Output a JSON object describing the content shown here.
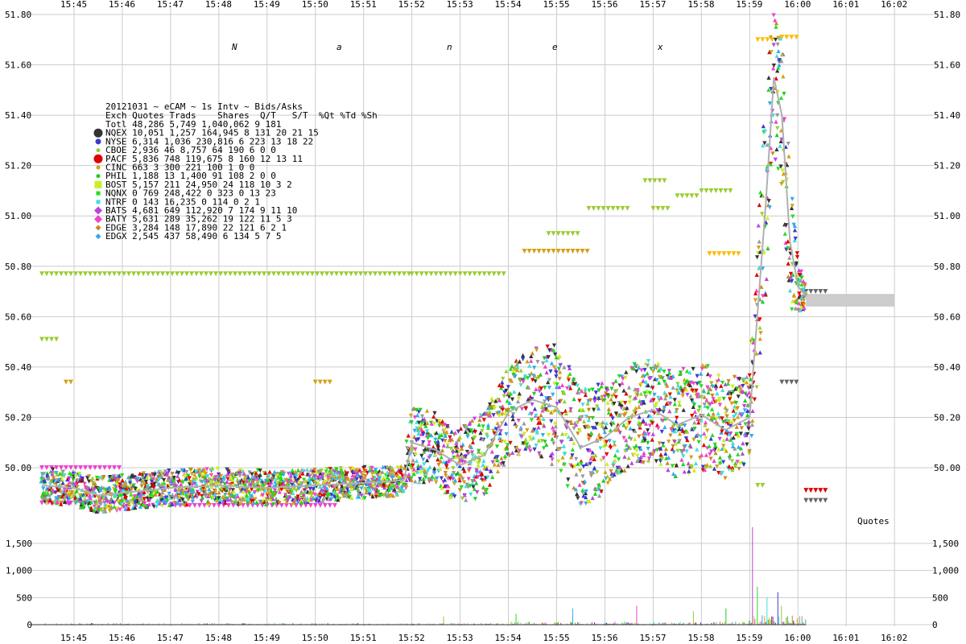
{
  "chart_data": {
    "type": "scatter",
    "watermark_letters": [
      "N",
      "a",
      "n",
      "e",
      "x"
    ],
    "x_ticks": [
      "15:45",
      "15:46",
      "15:47",
      "15:48",
      "15:49",
      "15:50",
      "15:51",
      "15:52",
      "15:53",
      "15:54",
      "15:55",
      "15:56",
      "15:57",
      "15:58",
      "15:59",
      "16:00",
      "16:01",
      "16:02"
    ],
    "price_axis": {
      "ylim": [
        49.78,
        51.82
      ],
      "ticks": [
        50.0,
        50.2,
        50.4,
        50.6,
        50.8,
        51.0,
        51.2,
        51.4,
        51.6,
        51.8
      ],
      "tick_labels": [
        "50.00",
        "50.20",
        "50.40",
        "50.60",
        "50.80",
        "51.00",
        "51.20",
        "51.40",
        "51.60",
        "51.80"
      ]
    },
    "volume_axis": {
      "ylim": [
        0,
        1800
      ],
      "ticks": [
        0,
        500,
        1000,
        1500
      ],
      "tick_labels": [
        "0",
        "500",
        "1,000",
        "1,500"
      ]
    },
    "panel_label": "Quotes",
    "legend": {
      "title": "20121031 ~ eCAM ~ 1s Intv ~ Bids/Asks",
      "header": "Exch Quotes Trads    Shares  Q/T   S/T  %Qt %Td %Sh",
      "rows": [
        {
          "text": "Totl 48,286 5,749 1,040,062    9   181",
          "color": "",
          "marker": "none"
        },
        {
          "text": "NQEX 10,051 1,257   164,945    8   131   20  21  15",
          "color": "#333333",
          "marker": "circle-large"
        },
        {
          "text": "NYSE  6,314 1,036   230,816    6   223   13  18  22",
          "color": "#3a3acc",
          "marker": "circle"
        },
        {
          "text": "CBOE  2,936    46     8,757   64   190    6   0   0",
          "color": "#9acd32",
          "marker": "circle-small"
        },
        {
          "text": "PACF  5,836   748   119,675    8   160   12  13  11",
          "color": "#e00000",
          "marker": "circle-large"
        },
        {
          "text": "CINC    663     3       300  221   100    1   0   0",
          "color": "#d4a017",
          "marker": "circle-small"
        },
        {
          "text": "PHIL  1,188    13     1,400   91   108    2   0   0",
          "color": "#22cc22",
          "marker": "circle-small"
        },
        {
          "text": "BOST  5,157   211    24,950   24   118   10   3   2",
          "color": "#ccee22",
          "marker": "square"
        },
        {
          "text": "NQNX      0   769   248,422    0   323    0  13  23",
          "color": "#22dd22",
          "marker": "square-small"
        },
        {
          "text": "NTRF      0   143    16,235    0   114    0   2   1",
          "color": "#44dddd",
          "marker": "square-small"
        },
        {
          "text": "BATS  4,681   649   112,920    7   174    9  11  10",
          "color": "#bb44dd",
          "marker": "diamond"
        },
        {
          "text": "BATY  5,631   289    35,262   19   122   11   5   3",
          "color": "#ee44cc",
          "marker": "diamond"
        },
        {
          "text": "EDGE  3,284   148    17,890   22   121    6   2   1",
          "color": "#cc8822",
          "marker": "diamond-small"
        },
        {
          "text": "EDGX  2,545   437    58,490    6   134    5   7   5",
          "color": "#33aaee",
          "marker": "diamond-small"
        }
      ]
    },
    "exchange_colors": [
      "#333333",
      "#3a3acc",
      "#9acd32",
      "#e00000",
      "#d4a017",
      "#22cc22",
      "#ccee22",
      "#22dd22",
      "#44dddd",
      "#bb44dd",
      "#ee44cc",
      "#cc8822",
      "#33aaee",
      "#999999"
    ],
    "mid_price_path": {
      "x": [
        "15:44:20",
        "15:45:00",
        "15:45:30",
        "15:46:00",
        "15:47:00",
        "15:48:00",
        "15:49:00",
        "15:50:00",
        "15:51:00",
        "15:51:50",
        "15:52:00",
        "15:52:30",
        "15:53:00",
        "15:53:30",
        "15:54:00",
        "15:54:30",
        "15:55:00",
        "15:55:30",
        "15:56:00",
        "15:56:30",
        "15:57:00",
        "15:57:30",
        "15:58:00",
        "15:58:30",
        "15:59:00",
        "15:59:20",
        "15:59:30",
        "15:59:40",
        "15:59:50",
        "16:00:00",
        "16:00:10"
      ],
      "y": [
        49.93,
        49.92,
        49.89,
        49.9,
        49.92,
        49.93,
        49.92,
        49.93,
        49.94,
        49.95,
        50.1,
        50.07,
        50.01,
        50.05,
        50.22,
        50.27,
        50.24,
        50.08,
        50.12,
        50.2,
        50.23,
        50.17,
        50.21,
        50.15,
        50.2,
        51.05,
        51.55,
        51.4,
        50.9,
        50.72,
        50.68
      ]
    },
    "dispersion_band": {
      "x": [
        "15:44:20",
        "15:48:00",
        "15:51:50",
        "15:52:00",
        "15:53:00",
        "15:54:00",
        "15:55:00",
        "15:56:00",
        "15:57:00",
        "15:58:00",
        "15:59:00",
        "15:59:20",
        "15:59:30",
        "15:59:50",
        "16:00:00",
        "16:00:10"
      ],
      "half_width": [
        0.07,
        0.07,
        0.06,
        0.15,
        0.15,
        0.18,
        0.25,
        0.22,
        0.2,
        0.22,
        0.18,
        0.45,
        0.3,
        0.3,
        0.1,
        0.05
      ]
    },
    "outlier_quotes": [
      {
        "x0": "15:44:20",
        "x1": "15:52:00",
        "y": 50.77,
        "color": "#9acd32"
      },
      {
        "x0": "15:52:00",
        "x1": "15:54:00",
        "y": 50.77,
        "color": "#9acd32"
      },
      {
        "x0": "15:44:20",
        "x1": "15:44:40",
        "y": 50.51,
        "color": "#9acd32"
      },
      {
        "x0": "15:44:50",
        "x1": "15:45:00",
        "y": 50.34,
        "color": "#d4a017"
      },
      {
        "x0": "15:50:00",
        "x1": "15:50:20",
        "y": 50.34,
        "color": "#d4a017"
      },
      {
        "x0": "15:44:20",
        "x1": "15:46:30",
        "y": 49.86,
        "color": "#ee44cc"
      },
      {
        "x0": "15:47:00",
        "x1": "15:50:30",
        "y": 49.85,
        "color": "#ee44cc"
      },
      {
        "x0": "15:44:20",
        "x1": "15:46:00",
        "y": 50.0,
        "color": "#ee44cc"
      },
      {
        "x0": "15:54:20",
        "x1": "15:55:40",
        "y": 50.86,
        "color": "#d4a017"
      },
      {
        "x0": "15:54:50",
        "x1": "15:55:30",
        "y": 50.93,
        "color": "#9acd32"
      },
      {
        "x0": "15:55:40",
        "x1": "15:56:30",
        "y": 51.03,
        "color": "#9acd32"
      },
      {
        "x0": "15:57:00",
        "x1": "15:57:20",
        "y": 51.03,
        "color": "#9acd32"
      },
      {
        "x0": "15:57:30",
        "x1": "15:58:00",
        "y": 51.08,
        "color": "#9acd32"
      },
      {
        "x0": "15:58:00",
        "x1": "15:58:40",
        "y": 51.1,
        "color": "#9acd32"
      },
      {
        "x0": "15:56:50",
        "x1": "15:57:20",
        "y": 51.14,
        "color": "#9acd32"
      },
      {
        "x0": "15:58:10",
        "x1": "15:58:50",
        "y": 50.85,
        "color": "#ffbb00"
      },
      {
        "x0": "15:59:10",
        "x1": "15:59:30",
        "y": 51.7,
        "color": "#ffbb00"
      },
      {
        "x0": "15:59:40",
        "x1": "16:00:00",
        "y": 51.71,
        "color": "#ffbb00"
      },
      {
        "x0": "16:00:10",
        "x1": "16:00:40",
        "y": 50.7,
        "color": "#666666"
      },
      {
        "x0": "16:00:10",
        "x1": "16:00:40",
        "y": 49.91,
        "color": "#e00000"
      },
      {
        "x0": "16:00:10",
        "x1": "16:00:40",
        "y": 49.87,
        "color": "#666666"
      },
      {
        "x0": "15:59:10",
        "x1": "15:59:20",
        "y": 49.93,
        "color": "#9acd32"
      },
      {
        "x0": "15:59:40",
        "x1": "16:00:00",
        "y": 50.34,
        "color": "#666666"
      }
    ],
    "closing_bar": {
      "x0": "16:00:10",
      "x1": "16:02:00",
      "y_low": 50.64,
      "y_high": 50.69,
      "color": "#cccccc"
    },
    "volume_bars": {
      "x0": "15:44:20",
      "x1": "16:00:10",
      "peak_times": [
        "15:59:03",
        "15:59:09",
        "15:59:22",
        "15:59:35",
        "15:59:40",
        "15:58:30",
        "15:55:20",
        "15:56:40",
        "15:54:10",
        "15:57:50",
        "15:52:40"
      ],
      "peak_values": [
        1800,
        700,
        500,
        600,
        350,
        300,
        300,
        350,
        200,
        250,
        150
      ]
    }
  }
}
